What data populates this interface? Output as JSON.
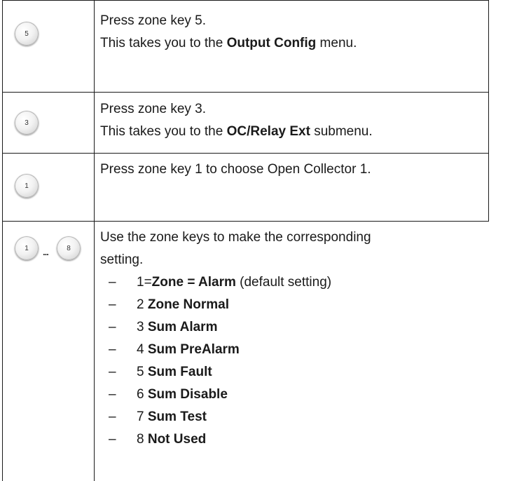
{
  "rows": [
    {
      "keys": [
        "5"
      ],
      "lines": [
        {
          "text": "Press zone key 5."
        },
        {
          "pre": "This takes you to the ",
          "bold": "Output Config",
          "post": " menu."
        }
      ]
    },
    {
      "keys": [
        "3"
      ],
      "lines": [
        {
          "text": "Press zone key 3."
        },
        {
          "pre": "This takes you to the ",
          "bold": "OC/Relay Ext",
          "post": " submenu."
        }
      ]
    },
    {
      "keys": [
        "1"
      ],
      "lines": [
        {
          "text": "Press zone key 1 to choose Open Collector 1."
        }
      ]
    },
    {
      "keys": [
        "1",
        "8"
      ],
      "ellipsis": "...",
      "lines": [
        {
          "text": "Use the zone keys to make the corresponding"
        },
        {
          "text": "setting."
        }
      ],
      "dash": "–",
      "items": [
        {
          "pre": "1=",
          "bold": "Zone = Alarm",
          "post": " (default setting)"
        },
        {
          "pre": "2 ",
          "bold": "Zone Normal",
          "post": ""
        },
        {
          "pre": "3 ",
          "bold": "Sum Alarm",
          "post": ""
        },
        {
          "pre": "4 ",
          "bold": "Sum PreAlarm",
          "post": ""
        },
        {
          "pre": "5 ",
          "bold": "Sum Fault",
          "post": ""
        },
        {
          "pre": "6 ",
          "bold": "Sum Disable",
          "post": ""
        },
        {
          "pre": "7 ",
          "bold": "Sum Test",
          "post": ""
        },
        {
          "pre": "8 ",
          "bold": "Not Used",
          "post": ""
        }
      ]
    }
  ]
}
